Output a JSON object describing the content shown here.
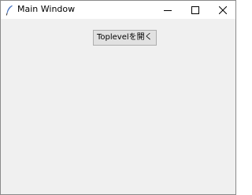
{
  "window": {
    "title": "Main Window",
    "controls": {
      "minimize_icon": "minimize-icon",
      "maximize_icon": "maximize-icon",
      "close_icon": "close-icon"
    },
    "app_icon": "feather-icon"
  },
  "main": {
    "button_label": "Toplevelを開く"
  },
  "colors": {
    "titlebar_bg": "#ffffff",
    "client_bg": "#f0f0f0",
    "button_bg": "#e1e1e1",
    "button_border": "#adadad",
    "icon_accent": "#4a74c0"
  }
}
